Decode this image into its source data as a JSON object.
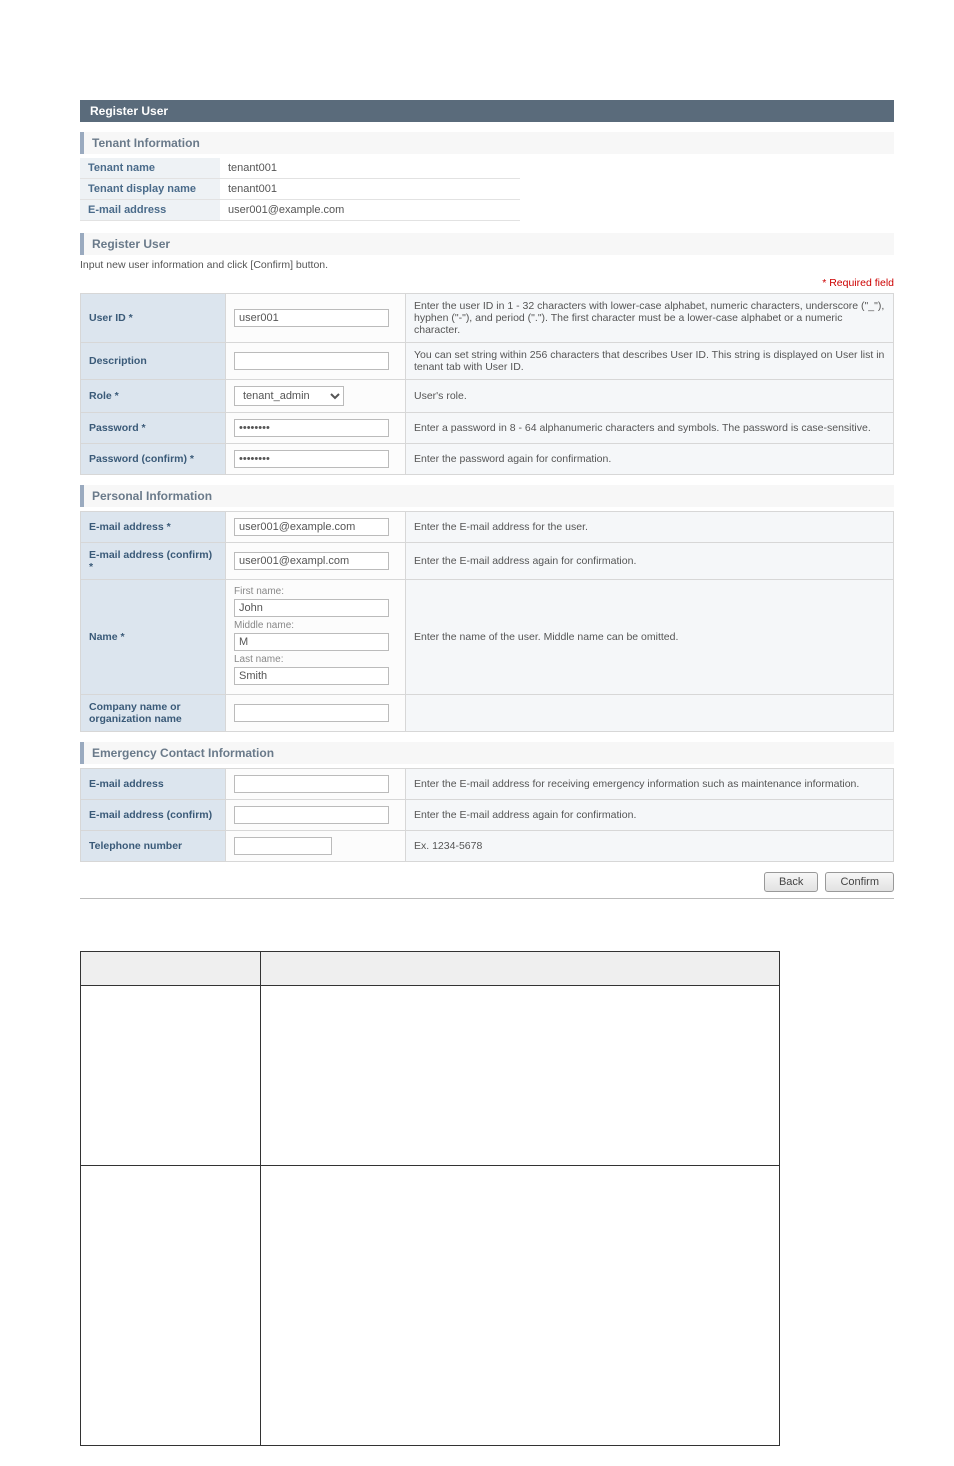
{
  "header": {
    "title": "Register User"
  },
  "tenant_info": {
    "section_label": "Tenant Information",
    "rows": [
      {
        "label": "Tenant name",
        "value": "tenant001"
      },
      {
        "label": "Tenant display name",
        "value": "tenant001"
      },
      {
        "label": "E-mail address",
        "value": "user001@example.com"
      }
    ]
  },
  "register_user": {
    "section_label": "Register User",
    "note": "Input new user information and click [Confirm] button.",
    "required_label": "* Required field",
    "fields": {
      "user_id": {
        "label": "User ID *",
        "value": "user001",
        "desc": "Enter the user ID in 1 - 32 characters with lower-case alphabet, numeric characters, underscore (\"_\"), hyphen (\"-\"), and period (\".\").\nThe first character must be a lower-case alphabet or a numeric character."
      },
      "description": {
        "label": "Description",
        "value": "",
        "desc": "You can set string within 256 characters that describes User ID.\nThis string is displayed on User list in tenant tab with User ID."
      },
      "role": {
        "label": "Role *",
        "value": "tenant_admin",
        "desc": "User's role."
      },
      "password": {
        "label": "Password *",
        "value": "password",
        "desc": "Enter a password in 8 - 64 alphanumeric characters and symbols.\nThe password is case-sensitive."
      },
      "password_confirm": {
        "label": "Password (confirm) *",
        "value": "password",
        "desc": "Enter the password again for confirmation."
      }
    }
  },
  "personal_info": {
    "section_label": "Personal Information",
    "email": {
      "label": "E-mail address *",
      "value": "user001@example.com",
      "desc": "Enter the E-mail address for the user."
    },
    "email_confirm": {
      "label": "E-mail address\n(confirm) *",
      "value": "user001@exampl.com",
      "desc": "Enter the E-mail address again for confirmation."
    },
    "name": {
      "label": "Name *",
      "first_lbl": "First name:",
      "first_val": "John",
      "middle_lbl": "Middle name:",
      "middle_val": "M",
      "last_lbl": "Last name:",
      "last_val": "Smith",
      "desc": "Enter the name of the user. Middle name can be omitted."
    },
    "company": {
      "label": "Company name or\norganization name",
      "value": "",
      "desc": ""
    }
  },
  "emergency": {
    "section_label": "Emergency Contact Information",
    "email": {
      "label": "E-mail address",
      "value": "",
      "desc": "Enter the E-mail address for receiving emergency information such as maintenance information."
    },
    "email_confirm": {
      "label": "E-mail address\n(confirm)",
      "value": "",
      "desc": "Enter the E-mail address again for confirmation."
    },
    "telephone": {
      "label": "Telephone number",
      "value": "",
      "desc": "Ex. 1234-5678"
    }
  },
  "buttons": {
    "back": "Back",
    "confirm": "Confirm"
  }
}
